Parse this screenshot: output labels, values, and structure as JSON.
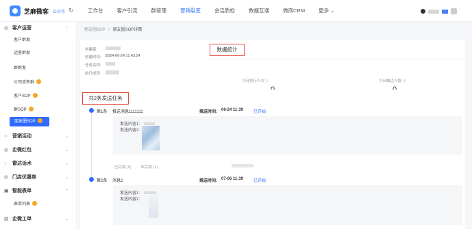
{
  "brand": {
    "name": "芝麻微客",
    "account": "公众号"
  },
  "nav": [
    "工作台",
    "客户引流",
    "群管理",
    "营销裂变",
    "会话质检",
    "数据互通",
    "微商CRM",
    "更多"
  ],
  "nav_active": 3,
  "sidebar": {
    "groups": [
      {
        "label": "客户运营",
        "icon": "◎",
        "expanded": true
      },
      {
        "label": "营销活动",
        "icon": "○"
      },
      {
        "label": "企微红包",
        "icon": "◎"
      },
      {
        "label": "雷达话术",
        "icon": "◌"
      },
      {
        "label": "门店优惠券",
        "icon": "◎"
      },
      {
        "label": "智能表单",
        "icon": "▣",
        "expanded": true
      },
      {
        "label": "企微工单",
        "icon": "▤"
      }
    ],
    "items": [
      "客户群发",
      "话客群发",
      "群群发",
      "公司流失群",
      "客户SOP",
      "群SOP",
      "朋友圈SOP",
      "表单列表"
    ],
    "active_item": "朋友圈SOP"
  },
  "breadcrumb": {
    "parent": "朋友圈SOP",
    "separator": "/",
    "current": "朋友圈SOP详情"
  },
  "info": {
    "labels": [
      "创建者:",
      "创建时间:",
      "任务名称:",
      "执行成员:"
    ],
    "created_time": "2024-06-24 11:43:24"
  },
  "stats": {
    "title": "数据统计",
    "executed_label": "今日执行人次",
    "executed_value": "0",
    "reached_label": "今日触达人数",
    "reached_value": "0"
  },
  "tasks": {
    "title": "共2条发送任务",
    "time_label": "推送时间:",
    "content_labels": [
      "发送内容1:",
      "发送内容2:"
    ],
    "items": [
      {
        "index": "第1条",
        "name": "推送消息1111111",
        "time": "06-24 11:39",
        "status": "已开始",
        "done": "已完成 (0)",
        "undone": "未完成 (1)"
      },
      {
        "index": "第2条",
        "name": "消息2",
        "time": "07-06 11:39",
        "status": "已开始"
      }
    ]
  },
  "colors": {
    "accent": "#2f6bff",
    "highlight_box": "#e04a3a",
    "badge": "#f5a623"
  }
}
